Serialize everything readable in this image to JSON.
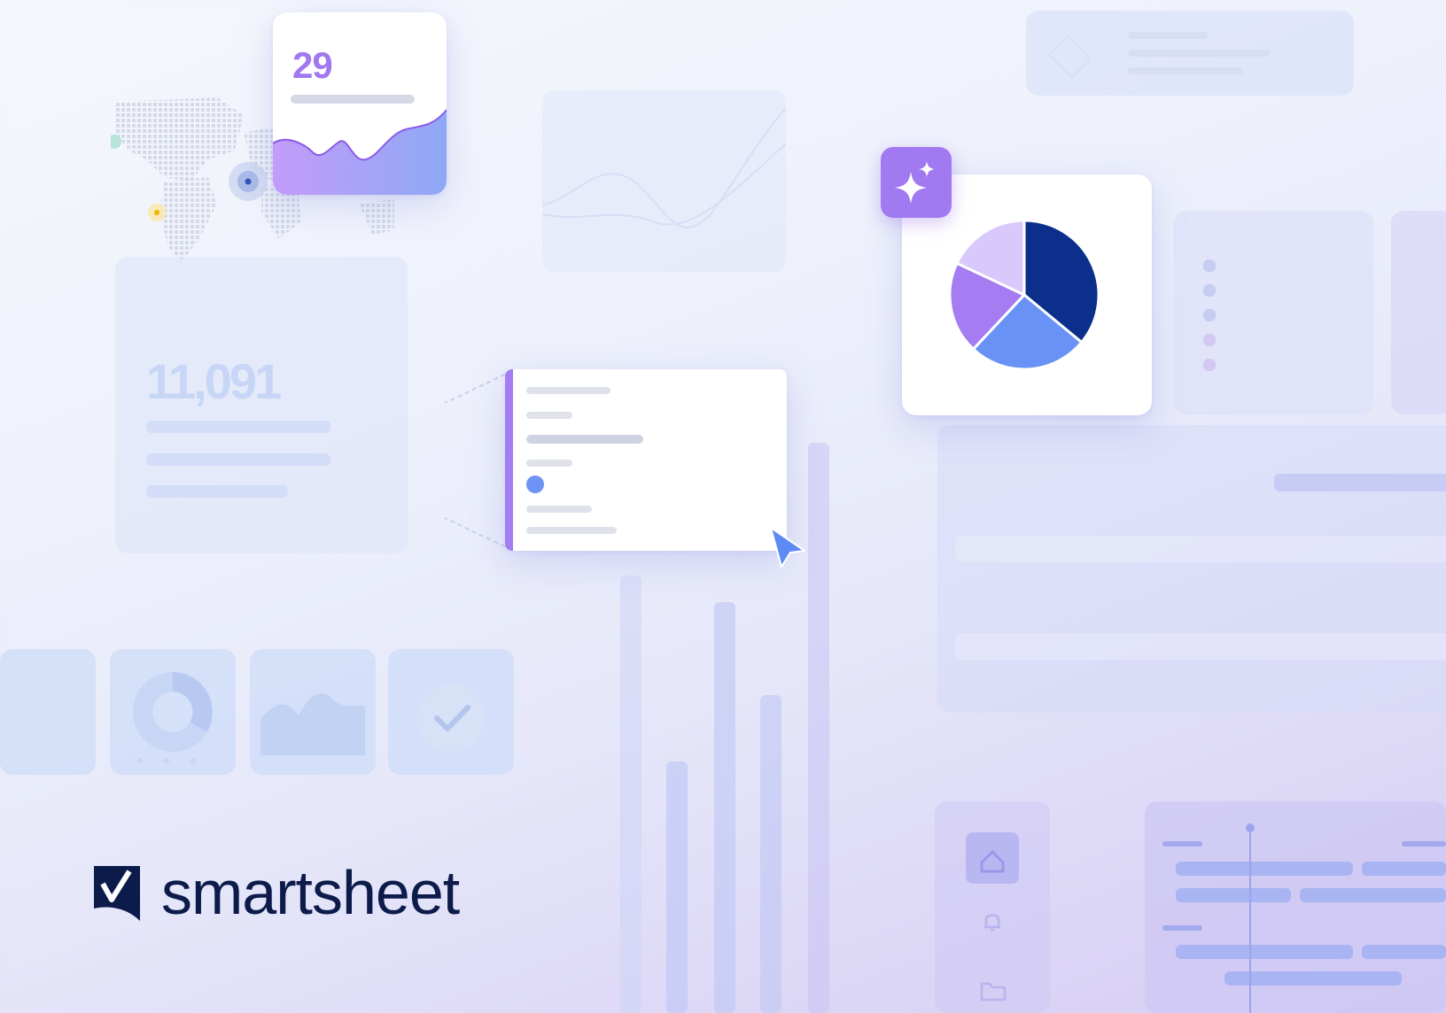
{
  "brand": {
    "name": "smartsheet",
    "logo_icon": "smartsheet-check-logo-icon",
    "color": "#0d1b4b"
  },
  "metric_card": {
    "value": "29",
    "accent": "#a078f0"
  },
  "faded_stat": {
    "value": "11,091"
  },
  "ai_badge": {
    "icon": "sparkles-icon",
    "color": "#a17af2"
  },
  "pie_chart": {
    "icon": "pie-chart",
    "slices": [
      {
        "share": 0.36,
        "color": "#0b2f8a"
      },
      {
        "share": 0.26,
        "color": "#6892f5"
      },
      {
        "share": 0.2,
        "color": "#a67cf2"
      },
      {
        "share": 0.18,
        "color": "#d9c8fb"
      }
    ]
  },
  "form_card": {
    "accent": "#a67cf2",
    "cursor_icon": "pointer-cursor-icon"
  },
  "sidebar_icons": [
    "home-icon",
    "bell-icon",
    "folder-icon"
  ],
  "widget_tiles": [
    "list-tile",
    "donut-chart-tile",
    "area-chart-tile",
    "check-tile"
  ]
}
